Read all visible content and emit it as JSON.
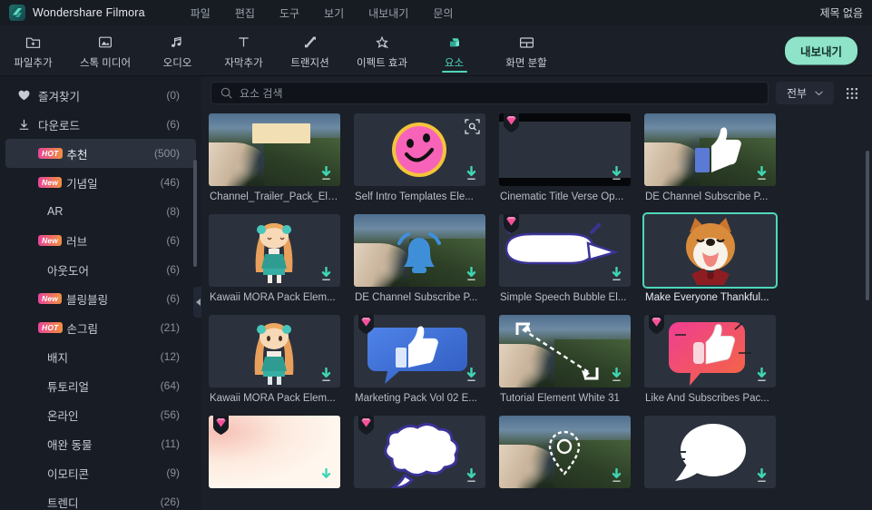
{
  "titlebar": {
    "app_name": "Wondershare Filmora",
    "logo_icon": "filmora-logo-icon",
    "menu": [
      {
        "label": "파일",
        "name": "menu-file"
      },
      {
        "label": "편집",
        "name": "menu-edit"
      },
      {
        "label": "도구",
        "name": "menu-tools"
      },
      {
        "label": "보기",
        "name": "menu-view"
      },
      {
        "label": "내보내기",
        "name": "menu-export"
      },
      {
        "label": "문의",
        "name": "menu-contact"
      }
    ],
    "document_title": "제목 없음"
  },
  "toolbar": {
    "items": [
      {
        "label": "파일추가",
        "icon": "folder-add-icon",
        "name": "tool-add-file",
        "active": false
      },
      {
        "label": "스톡 미디어",
        "icon": "stock-media-icon",
        "name": "tool-stock-media",
        "active": false
      },
      {
        "label": "오디오",
        "icon": "audio-note-icon",
        "name": "tool-audio",
        "active": false
      },
      {
        "label": "자막추가",
        "icon": "text-title-icon",
        "name": "tool-add-subtitle",
        "active": false
      },
      {
        "label": "트랜지션",
        "icon": "transition-icon",
        "name": "tool-transition",
        "active": false
      },
      {
        "label": "이펙트 효과",
        "icon": "effects-star-icon",
        "name": "tool-effects",
        "active": false
      },
      {
        "label": "요소",
        "icon": "elements-icon",
        "name": "tool-elements",
        "active": true
      },
      {
        "label": "화면 분할",
        "icon": "split-screen-icon",
        "name": "tool-split-screen",
        "active": false
      }
    ],
    "export_label": "내보내기",
    "accent_color": "#8ee3c8"
  },
  "sidebar": {
    "scrollbar_visible": true,
    "collapse_icon": "chevron-left-icon",
    "items": [
      {
        "label": "즐겨찾기",
        "count": "(0)",
        "icon": "heart-icon",
        "badge": "",
        "selected": false,
        "indent": false
      },
      {
        "label": "다운로드",
        "count": "(6)",
        "icon": "download-icon",
        "badge": "",
        "selected": false,
        "indent": false
      },
      {
        "label": "추천",
        "count": "(500)",
        "icon": "",
        "badge": "HOT",
        "selected": true,
        "indent": false
      },
      {
        "label": "기념일",
        "count": "(46)",
        "icon": "",
        "badge": "New",
        "selected": false,
        "indent": false
      },
      {
        "label": "AR",
        "count": "(8)",
        "icon": "",
        "badge": "",
        "selected": false,
        "indent": true
      },
      {
        "label": "러브",
        "count": "(6)",
        "icon": "",
        "badge": "New",
        "selected": false,
        "indent": false
      },
      {
        "label": "아웃도어",
        "count": "(6)",
        "icon": "",
        "badge": "",
        "selected": false,
        "indent": true
      },
      {
        "label": "블링블링",
        "count": "(6)",
        "icon": "",
        "badge": "New",
        "selected": false,
        "indent": false
      },
      {
        "label": "손그림",
        "count": "(21)",
        "icon": "",
        "badge": "HOT",
        "selected": false,
        "indent": false
      },
      {
        "label": "배지",
        "count": "(12)",
        "icon": "",
        "badge": "",
        "selected": false,
        "indent": true
      },
      {
        "label": "튜토리얼",
        "count": "(64)",
        "icon": "",
        "badge": "",
        "selected": false,
        "indent": true
      },
      {
        "label": "온라인",
        "count": "(56)",
        "icon": "",
        "badge": "",
        "selected": false,
        "indent": true
      },
      {
        "label": "애완 동물",
        "count": "(11)",
        "icon": "",
        "badge": "",
        "selected": false,
        "indent": true
      },
      {
        "label": "이모티콘",
        "count": "(9)",
        "icon": "",
        "badge": "",
        "selected": false,
        "indent": true
      },
      {
        "label": "트렌디",
        "count": "(26)",
        "icon": "",
        "badge": "",
        "selected": false,
        "indent": true
      }
    ]
  },
  "search": {
    "placeholder": "요소 검색",
    "value": "",
    "icon": "search-icon",
    "filter_label": "전부",
    "filter_icon": "chevron-down-icon",
    "grid_toggle_icon": "grid-view-icon"
  },
  "grid": {
    "scrollbar_visible": true,
    "cards": [
      {
        "title": "Channel_Trailer_Pack_Ele...",
        "art": "vineyard-beige-bar",
        "gem": false,
        "download": true,
        "preview": false,
        "selected": false
      },
      {
        "title": "Self Intro Templates Ele...",
        "art": "pink-smiley",
        "gem": false,
        "download": true,
        "preview": true,
        "selected": false
      },
      {
        "title": "Cinematic Title Verse Op...",
        "art": "letterbox-dark",
        "gem": true,
        "download": true,
        "preview": false,
        "selected": false
      },
      {
        "title": "DE Channel Subscribe P...",
        "art": "vineyard-thumbsup",
        "gem": false,
        "download": true,
        "preview": false,
        "selected": false
      },
      {
        "title": "Kawaii MORA Pack Elem...",
        "art": "kawaii-girl",
        "gem": false,
        "download": true,
        "preview": false,
        "selected": false
      },
      {
        "title": "DE Channel Subscribe P...",
        "art": "vineyard-bell",
        "gem": false,
        "download": true,
        "preview": false,
        "selected": false
      },
      {
        "title": "Simple Speech Bubble El...",
        "art": "speech-oval",
        "gem": true,
        "download": true,
        "preview": false,
        "selected": false
      },
      {
        "title": "Make Everyone Thankful...",
        "art": "shiba-dog",
        "gem": false,
        "download": false,
        "preview": false,
        "selected": true
      },
      {
        "title": "Kawaii MORA Pack Elem...",
        "art": "kawaii-girl-2",
        "gem": false,
        "download": true,
        "preview": false,
        "selected": false
      },
      {
        "title": "Marketing Pack Vol 02 E...",
        "art": "blue-thumb-bubble",
        "gem": true,
        "download": true,
        "preview": false,
        "selected": false
      },
      {
        "title": "Tutorial Element White 31",
        "art": "vineyard-arrow",
        "gem": false,
        "download": true,
        "preview": false,
        "selected": false
      },
      {
        "title": "Like And Subscribes Pac...",
        "art": "pink-thumb-bubble",
        "gem": true,
        "download": true,
        "preview": false,
        "selected": false
      },
      {
        "title": "",
        "art": "peach-soft",
        "gem": true,
        "download": true,
        "preview": false,
        "selected": false
      },
      {
        "title": "",
        "art": "cloud-bubble",
        "gem": true,
        "download": true,
        "preview": false,
        "selected": false
      },
      {
        "title": "",
        "art": "vineyard-pin",
        "gem": false,
        "download": true,
        "preview": false,
        "selected": false
      },
      {
        "title": "",
        "art": "white-bubble",
        "gem": false,
        "download": true,
        "preview": false,
        "selected": false
      }
    ]
  }
}
